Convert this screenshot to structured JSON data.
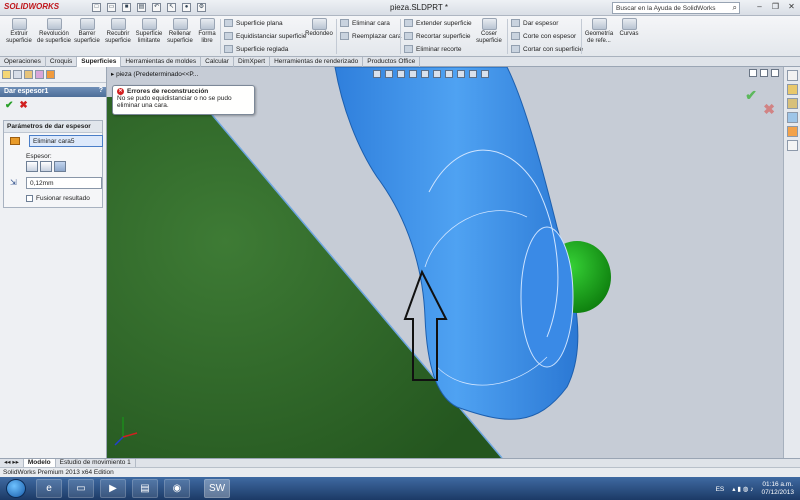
{
  "app": {
    "logo": "SOLIDWORKS",
    "doc_title": "pieza.SLDPRT *",
    "help_placeholder": "Buscar en la Ayuda de SolidWorks"
  },
  "ribbon": {
    "big": [
      {
        "label": "Extruir superficie"
      },
      {
        "label": "Revolución de superficie"
      },
      {
        "label": "Barrer superficie"
      },
      {
        "label": "Recubrir superficie"
      },
      {
        "label": "Superficie limitante"
      },
      {
        "label": "Rellenar superficie"
      },
      {
        "label": "Forma libre"
      }
    ],
    "small": {
      "sup_plana": "Superficie plana",
      "equidistanciar": "Equidistanciar superficie",
      "reglada": "Superficie reglada",
      "redondeo": "Redondeo",
      "eliminar_cara": "Eliminar cara",
      "reemplazar_cara": "Reemplazar cara",
      "extender": "Extender superficie",
      "recortar": "Recortar superficie",
      "eliminar_recorte": "Eliminar recorte",
      "coser": "Coser superficie",
      "dar_espesor": "Dar espesor",
      "corte_espesor": "Corte con espesor",
      "cortar_superficie": "Cortar con superficie",
      "geometria": "Geometría de refe...",
      "curvas": "Curvas"
    }
  },
  "tabs": [
    "Operaciones",
    "Croquis",
    "Superficies",
    "Herramientas de moldes",
    "Calcular",
    "DimXpert",
    "Herramientas de renderizado",
    "Productos Office"
  ],
  "active_tab": "Superficies",
  "panel": {
    "title": "Dar espesor1",
    "help": "?",
    "group_title": "Parámetros de dar espesor",
    "face_value": "Eliminar cara5",
    "espesor_label": "Espesor:",
    "thickness": "0,12mm",
    "merge_label": "Fusionar resultado"
  },
  "viewport": {
    "tree_label": "pieza  (Predeterminado<<P...",
    "error_title": "Errores de reconstrucción",
    "error_text": "No se pudo equidistanciar o no se pudo eliminar una cara."
  },
  "bottom_tabs": [
    "Modelo",
    "Estudio de movimiento 1"
  ],
  "active_bottom_tab": "Modelo",
  "status": "SolidWorks Premium 2013 x64 Edition",
  "taskbar": {
    "lang": "ES",
    "time": "01:16 a.m.",
    "date": "07/12/2013"
  },
  "colors": {
    "surface_blue": "#3f8fe6",
    "plane_green": "#2f6a2a",
    "sphere_green": "#1aa31a",
    "background": "#c6ccd6"
  }
}
